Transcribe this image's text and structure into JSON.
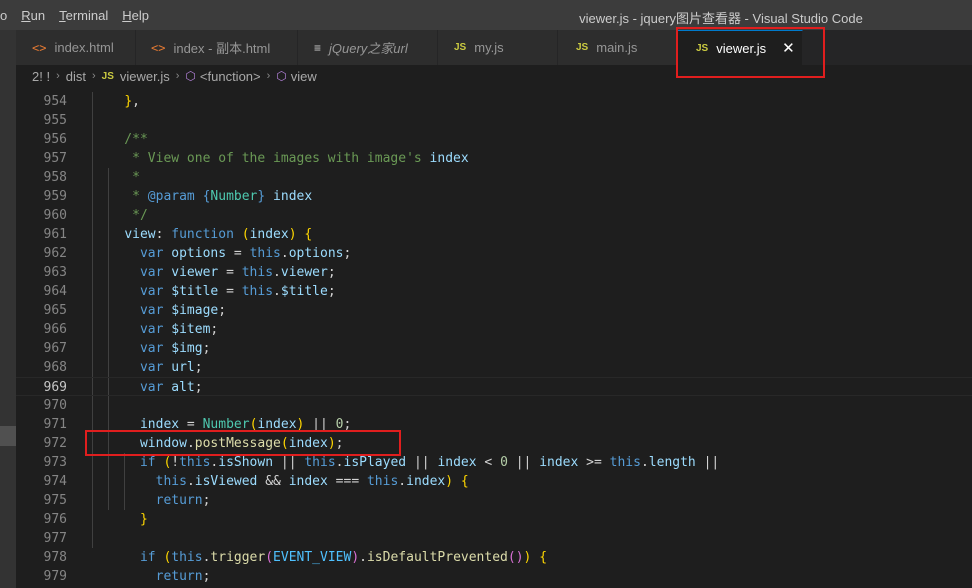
{
  "menu": {
    "items": [
      "o",
      "Run",
      "Terminal",
      "Help"
    ]
  },
  "window_title": "viewer.js - jquery图片查看器 - Visual Studio Code",
  "tabs": [
    {
      "icon": "html-icon",
      "glyph": "<>",
      "label": "index.html",
      "italic": false,
      "active": false
    },
    {
      "icon": "html-icon",
      "glyph": "<>",
      "label": "index - 副本.html",
      "italic": false,
      "active": false
    },
    {
      "icon": "doc-icon",
      "glyph": "≡",
      "label": "jQuery之家url",
      "italic": true,
      "active": false
    },
    {
      "icon": "js-icon",
      "glyph": "JS",
      "label": "my.js",
      "italic": false,
      "active": false
    },
    {
      "icon": "js-icon",
      "glyph": "JS",
      "label": "main.js",
      "italic": false,
      "active": false
    },
    {
      "icon": "js-icon",
      "glyph": "JS",
      "label": "viewer.js",
      "italic": false,
      "active": true,
      "close": "✕"
    }
  ],
  "breadcrumb": {
    "problems": "2! !",
    "folder": "dist",
    "file_badge": "JS",
    "file": "viewer.js",
    "symbol1": "<function>",
    "symbol2": "view",
    "separator": "›"
  },
  "colors": {
    "accent": "#007acc",
    "highlight_box": "#e01e1e",
    "js_badge": "#cbcb41",
    "html_badge": "#e37933"
  },
  "code": {
    "active_line": 969,
    "line_numbers": [
      954,
      955,
      956,
      957,
      958,
      959,
      960,
      961,
      962,
      963,
      964,
      965,
      966,
      967,
      968,
      969,
      970,
      971,
      972,
      973,
      974,
      975,
      976,
      977,
      978,
      979
    ],
    "lines": [
      "    },",
      "",
      "    /**",
      "     * View one of the images with image's index",
      "     *",
      "     * @param {Number} index",
      "     */",
      "    view: function (index) {",
      "      var options = this.options;",
      "      var viewer = this.viewer;",
      "      var $title = this.$title;",
      "      var $image;",
      "      var $item;",
      "      var $img;",
      "      var url;",
      "      var alt;",
      "",
      "      index = Number(index) || 0;",
      "      window.postMessage(index);",
      "      if (!this.isShown || this.isPlayed || index < 0 || index >= this.length ||",
      "        this.isViewed && index === this.index) {",
      "        return;",
      "      }",
      "",
      "      if (this.trigger(EVENT_VIEW).isDefaultPrevented()) {",
      "        return;"
    ]
  }
}
